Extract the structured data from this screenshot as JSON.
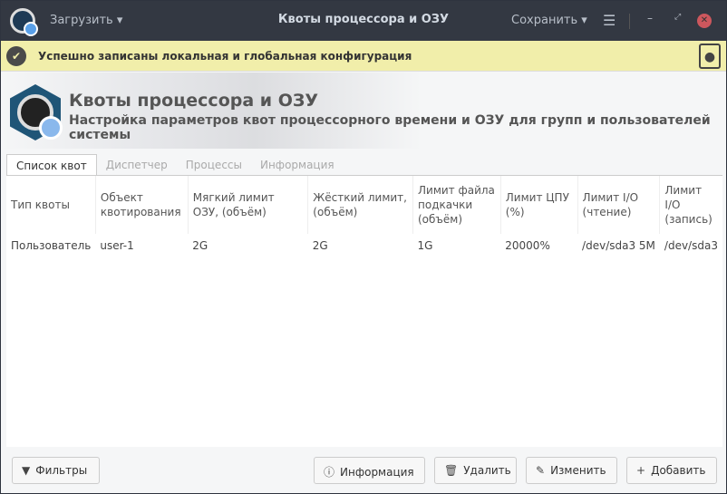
{
  "titlebar": {
    "load": "Загрузить",
    "title": "Квоты процессора и ОЗУ",
    "save": "Сохранить"
  },
  "info": {
    "message": "Успешно записаны локальная и глобальная конфигурация"
  },
  "banner": {
    "title": "Квоты процессора и ОЗУ",
    "subtitle": "Настройка параметров квот процессорного времени и ОЗУ для групп и пользователей системы"
  },
  "tabs": [
    {
      "label": "Список квот"
    },
    {
      "label": "Диспетчер"
    },
    {
      "label": "Процессы"
    },
    {
      "label": "Информация"
    }
  ],
  "table": {
    "columns": [
      "Тип квоты",
      "Объект квотирования",
      "Мягкий лимит ОЗУ, (объём)",
      "Жёсткий лимит, (объём)",
      "Лимит файла подкачки (объём)",
      "Лимит ЦПУ (%)",
      "Лимит I/O (чтение)",
      "Лимит I/O (запись)"
    ],
    "rows": [
      [
        "Пользователь",
        "user-1",
        "2G",
        "2G",
        "1G",
        "20000%",
        "/dev/sda3 5M",
        "/dev/sda3"
      ]
    ]
  },
  "buttons": {
    "filters": "Фильтры",
    "info": "Информация",
    "delete": "Удалить",
    "edit": "Изменить",
    "add": "Добавить"
  }
}
